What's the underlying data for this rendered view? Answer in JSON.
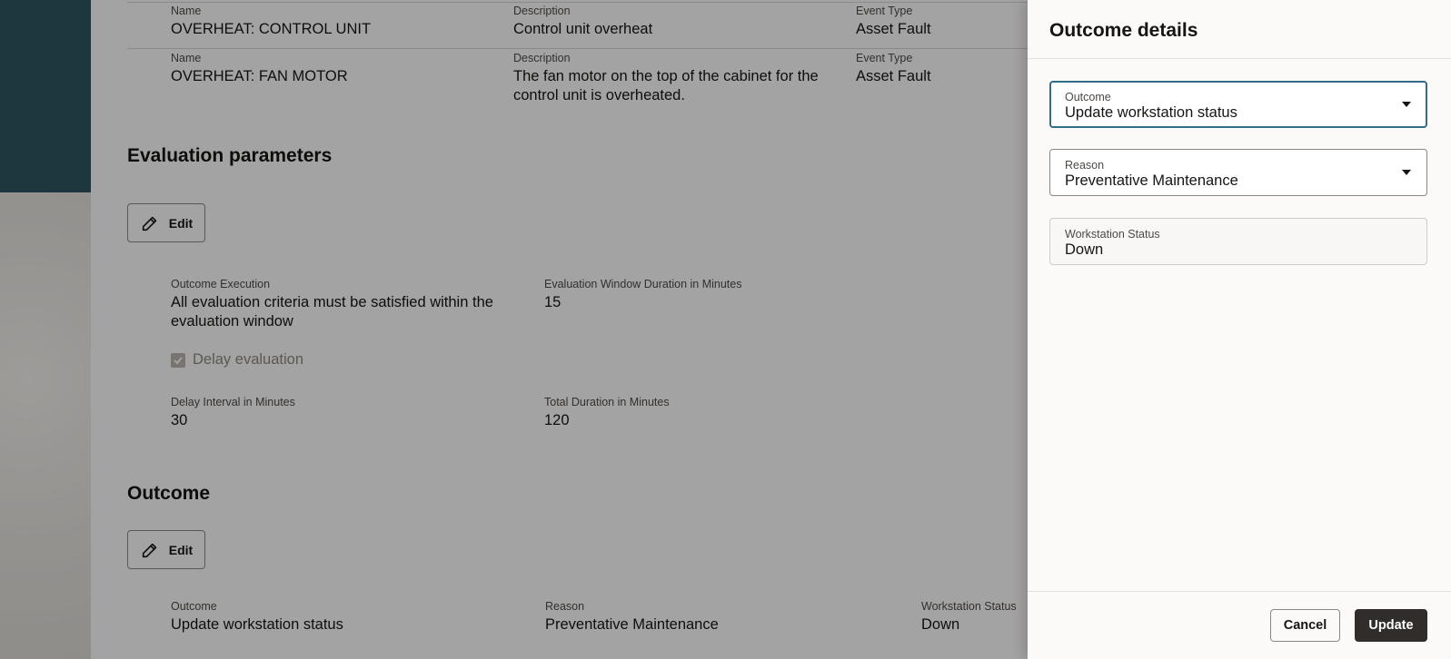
{
  "events": [
    {
      "name_label": "Name",
      "name": "OVERHEAT: CONTROL UNIT",
      "desc_label": "Description",
      "description": "Control unit overheat",
      "type_label": "Event Type",
      "type": "Asset Fault"
    },
    {
      "name_label": "Name",
      "name": "OVERHEAT: FAN MOTOR",
      "desc_label": "Description",
      "description": "The fan motor on the top of the cabinet for the control unit is overheated.",
      "type_label": "Event Type",
      "type": "Asset Fault"
    }
  ],
  "evaluation": {
    "title": "Evaluation parameters",
    "edit_label": "Edit",
    "outcome_execution_label": "Outcome Execution",
    "outcome_execution": "All evaluation criteria must be satisfied within the evaluation window",
    "window_label": "Evaluation Window Duration in Minutes",
    "window": "15",
    "delay_checkbox_label": "Delay evaluation",
    "delay_checked": true,
    "delay_interval_label": "Delay Interval in Minutes",
    "delay_interval": "30",
    "total_label": "Total Duration in Minutes",
    "total": "120"
  },
  "outcome": {
    "title": "Outcome",
    "edit_label": "Edit",
    "outcome_label": "Outcome",
    "outcome": "Update workstation status",
    "reason_label": "Reason",
    "reason": "Preventative Maintenance",
    "status_label": "Workstation Status",
    "status": "Down"
  },
  "drawer": {
    "title": "Outcome details",
    "outcome_label": "Outcome",
    "outcome_value": "Update workstation status",
    "reason_label": "Reason",
    "reason_value": "Preventative Maintenance",
    "status_label": "Workstation Status",
    "status_value": "Down",
    "cancel_label": "Cancel",
    "update_label": "Update"
  },
  "colors": {
    "accent_focus": "#2f6f86",
    "primary_button": "#312d2a",
    "left_panel": "#2f5560"
  }
}
